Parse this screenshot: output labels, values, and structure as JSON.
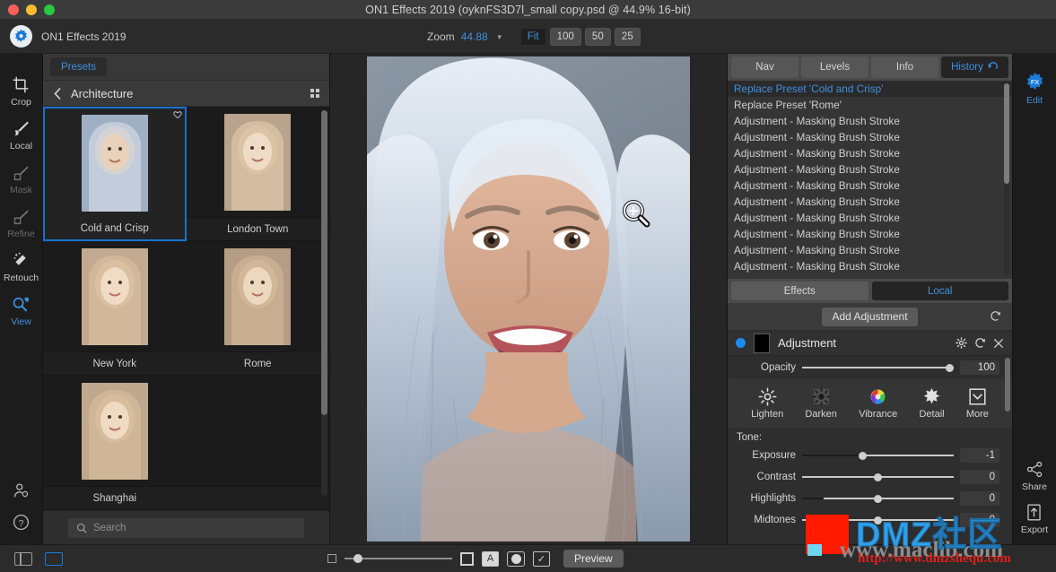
{
  "window": {
    "title": "ON1 Effects 2019 (oyknFS3D7l_small copy.psd @ 44.9% 16-bit)",
    "traffic_colors": {
      "close": "#ff5f57",
      "minimize": "#febc2e",
      "zoom": "#28c840"
    }
  },
  "toolbar": {
    "brand": "ON1 Effects 2019",
    "zoom_label": "Zoom",
    "zoom_value": "44.88",
    "zoom_buttons": [
      {
        "label": "Fit",
        "active": true
      },
      {
        "label": "100",
        "active": false
      },
      {
        "label": "50",
        "active": false
      },
      {
        "label": "25",
        "active": false
      }
    ]
  },
  "left_rail": {
    "items": [
      {
        "label": "Crop",
        "icon": "crop-icon",
        "state": "normal"
      },
      {
        "label": "Local",
        "icon": "brush-icon",
        "state": "normal"
      },
      {
        "label": "Mask",
        "icon": "mask-icon",
        "state": "disabled"
      },
      {
        "label": "Refine",
        "icon": "refine-icon",
        "state": "disabled"
      },
      {
        "label": "Retouch",
        "icon": "eraser-icon",
        "state": "normal"
      },
      {
        "label": "View",
        "icon": "magnifier-hand-icon",
        "state": "active"
      }
    ],
    "bottom_icons": [
      {
        "icon": "account-icon"
      },
      {
        "icon": "help-icon"
      }
    ]
  },
  "presets": {
    "tab_label": "Presets",
    "category": "Architecture",
    "back_icon": "chevron-left-icon",
    "grid_icon": "grid-view-icon",
    "items": [
      {
        "name": "Cold and Crisp",
        "selected": true,
        "favorite": true
      },
      {
        "name": "London Town",
        "selected": false,
        "favorite": false
      },
      {
        "name": "New York",
        "selected": false,
        "favorite": false
      },
      {
        "name": "Rome",
        "selected": false,
        "favorite": false
      },
      {
        "name": "Shanghai",
        "selected": false,
        "favorite": false
      }
    ],
    "search_placeholder": "Search",
    "search_value": "",
    "search_icon": "search-icon"
  },
  "canvas": {
    "cursor_icon": "zoom-in-cursor-icon"
  },
  "right_panel": {
    "tabs": [
      {
        "label": "Nav",
        "active": false
      },
      {
        "label": "Levels",
        "active": false
      },
      {
        "label": "Info",
        "active": false
      },
      {
        "label": "History",
        "active": true,
        "icon": "undo-icon"
      }
    ],
    "history": [
      {
        "label": "Replace Preset 'Cold and Crisp'",
        "selected": true
      },
      {
        "label": "Replace Preset 'Rome'",
        "selected": false
      },
      {
        "label": "Adjustment - Masking Brush Stroke",
        "selected": false
      },
      {
        "label": "Adjustment - Masking Brush Stroke",
        "selected": false
      },
      {
        "label": "Adjustment - Masking Brush Stroke",
        "selected": false
      },
      {
        "label": "Adjustment - Masking Brush Stroke",
        "selected": false
      },
      {
        "label": "Adjustment - Masking Brush Stroke",
        "selected": false
      },
      {
        "label": "Adjustment - Masking Brush Stroke",
        "selected": false
      },
      {
        "label": "Adjustment - Masking Brush Stroke",
        "selected": false
      },
      {
        "label": "Adjustment - Masking Brush Stroke",
        "selected": false
      },
      {
        "label": "Adjustment - Masking Brush Stroke",
        "selected": false
      },
      {
        "label": "Adjustment - Masking Brush Stroke",
        "selected": false
      }
    ],
    "editor_tabs": [
      {
        "label": "Effects",
        "active": false
      },
      {
        "label": "Local",
        "active": true
      }
    ],
    "add_adjustment_label": "Add Adjustment",
    "add_reset_icon": "reset-icon",
    "adjustment": {
      "title": "Adjustment",
      "enabled_dot_color": "#1a8cf0",
      "mask_thumb_color": "#000000",
      "icons": [
        "gear-icon",
        "reset-icon",
        "close-icon"
      ],
      "opacity_label": "Opacity",
      "opacity_value": "100",
      "quick_tools": [
        {
          "label": "Lighten",
          "icon": "sun-outline-icon"
        },
        {
          "label": "Darken",
          "icon": "sun-filled-icon"
        },
        {
          "label": "Vibrance",
          "icon": "color-wheel-icon"
        },
        {
          "label": "Detail",
          "icon": "starburst-icon"
        },
        {
          "label": "More",
          "icon": "chevron-down-box-icon"
        }
      ],
      "tone_header": "Tone:",
      "tone_sliders": [
        {
          "label": "Exposure",
          "value": "-1",
          "knob": 40
        },
        {
          "label": "Contrast",
          "value": "0",
          "knob": 50
        },
        {
          "label": "Highlights",
          "value": "0",
          "knob": 50
        },
        {
          "label": "Midtones",
          "value": "0",
          "knob": 50
        }
      ]
    }
  },
  "right_rail": {
    "top": [
      {
        "label": "Edit",
        "icon": "fx-icon",
        "active": true
      }
    ],
    "bottom": [
      {
        "label": "Share",
        "icon": "share-icon",
        "active": false
      },
      {
        "label": "Export",
        "icon": "export-icon",
        "active": false
      }
    ]
  },
  "bottom_bar": {
    "panel_toggle_icon": "panel-toggle-icon",
    "view_mode_icon": "view-mode-icon",
    "thumb_small_icon": "small-thumbnail-icon",
    "thumb_large_icon": "large-thumbnail-icon",
    "letter_icon": "A",
    "circle_icon": "circle-overlay-icon",
    "check_icon": "checkmark-box-icon",
    "preview_label": "Preview",
    "slider_value": 8
  },
  "watermark": {
    "brand": "DMZ社区",
    "site": "www.maclib.com",
    "url": "http://www.dmzshequ.com",
    "brand_color": "#2f9fe8",
    "url_color": "#e02018",
    "block_color": "#ff1a00"
  }
}
